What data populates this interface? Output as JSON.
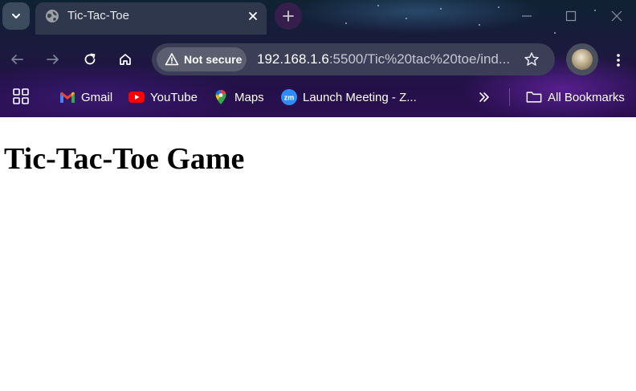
{
  "browser": {
    "tab": {
      "title": "Tic-Tac-Toe"
    },
    "address_bar": {
      "security_label": "Not secure",
      "url_host": "192.168.1.6",
      "url_rest": ":5500/Tic%20tac%20toe/ind..."
    },
    "bookmarks": {
      "items": [
        {
          "label": "Gmail",
          "icon": "gmail-icon"
        },
        {
          "label": "YouTube",
          "icon": "youtube-icon"
        },
        {
          "label": "Maps",
          "icon": "maps-icon"
        },
        {
          "label": "Launch Meeting - Z...",
          "icon": "zoom-icon"
        }
      ],
      "all_bookmarks_label": "All Bookmarks"
    },
    "colors": {
      "frame": "#1a1a3c",
      "omnibox": "#3e4258",
      "security_chip": "#5a5e6e",
      "youtube_red": "#ff0000",
      "zoom_blue": "#2d8cff"
    }
  },
  "page": {
    "heading": "Tic-Tac-Toe Game",
    "background": "#ffffff"
  }
}
